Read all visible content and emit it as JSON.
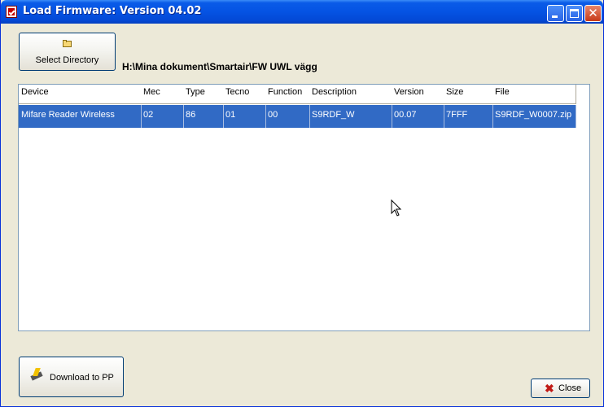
{
  "window": {
    "title": "Load Firmware: Version 04.02"
  },
  "icons": {
    "app": "firmware-app-icon",
    "minimize": "minimize-icon",
    "maximize": "maximize-icon",
    "close": "close-icon",
    "folder": "folder-open-icon",
    "download": "chip-lightning-icon",
    "close_x": "red-x-icon",
    "cursor": "mouse-pointer-icon"
  },
  "toolbar": {
    "select_directory_label": "Select Directory",
    "path": "H:\\Mina dokument\\Smartair\\FW UWL vägg"
  },
  "table": {
    "columns": [
      "Device",
      "Mec",
      "Type",
      "Tecno",
      "Function",
      "Description",
      "Version",
      "Size",
      "File"
    ],
    "rows": [
      [
        "Mifare Reader Wireless",
        "02",
        "86",
        "01",
        "00",
        "S9RDF_W",
        "00.07",
        "7FFF",
        "S9RDF_W0007.zip"
      ]
    ]
  },
  "footer": {
    "download_label": "Download to PP",
    "close_label": "Close"
  },
  "colors": {
    "titlebar": "#0553E3",
    "selection": "#316AC5",
    "face": "#ECE9D8"
  }
}
